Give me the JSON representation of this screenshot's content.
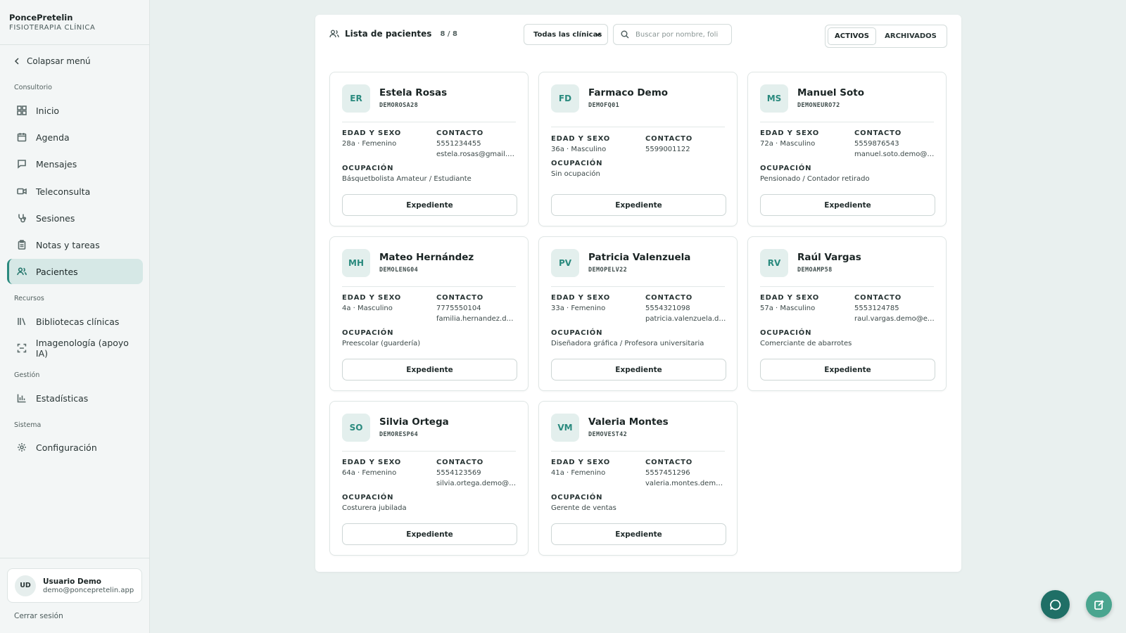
{
  "brand": {
    "name": "PoncePretelin",
    "subtitle": "FISIOTERAPIA CLÍNICA"
  },
  "sidebar": {
    "collapse_label": "Colapsar menú",
    "sections": {
      "consultorio": "Consultorio",
      "recursos": "Recursos",
      "gestion": "Gestión",
      "sistema": "Sistema"
    },
    "items": [
      {
        "label": "Inicio",
        "icon": "grid-icon"
      },
      {
        "label": "Agenda",
        "icon": "calendar-icon"
      },
      {
        "label": "Mensajes",
        "icon": "message-icon"
      },
      {
        "label": "Teleconsulta",
        "icon": "video-icon"
      },
      {
        "label": "Sesiones",
        "icon": "stethoscope-icon"
      },
      {
        "label": "Notas y tareas",
        "icon": "clipboard-icon"
      },
      {
        "label": "Pacientes",
        "icon": "users-icon",
        "active": true
      },
      {
        "label": "Bibliotecas clínicas",
        "icon": "library-icon"
      },
      {
        "label": "Imagenología (apoyo IA)",
        "icon": "scan-icon"
      },
      {
        "label": "Estadísticas",
        "icon": "bar-chart-icon"
      },
      {
        "label": "Configuración",
        "icon": "gear-icon"
      }
    ],
    "user": {
      "initials": "UD",
      "name": "Usuario Demo",
      "email": "demo@poncepretelin.app"
    },
    "logout_label": "Cerrar sesión"
  },
  "main": {
    "title": "Lista de pacientes",
    "count": "8 / 8",
    "clinic_select": "Todas las clínicas",
    "search_placeholder": "Buscar por nombre, foli",
    "tabs": {
      "active": "ACTIVOS",
      "archived": "ARCHIVADOS"
    },
    "labels": {
      "age_sex": "EDAD Y SEXO",
      "contact": "CONTACTO",
      "occupation": "OCUPACIÓN",
      "record_button": "Expediente"
    },
    "patients": [
      {
        "initials": "ER",
        "name": "Estela Rosas",
        "code": "DEMOROSA28",
        "age_sex": "28a · Femenino",
        "phone": "5551234455",
        "email": "estela.rosas@gmail.com",
        "occupation": "Básquetbolista Amateur / Estudiante"
      },
      {
        "initials": "FD",
        "name": "Farmaco Demo",
        "code": "DEMOFQ01",
        "age_sex": "36a · Masculino",
        "phone": "5599001122",
        "email": "",
        "occupation": "Sin ocupación"
      },
      {
        "initials": "MS",
        "name": "Manuel Soto",
        "code": "DEMONEURO72",
        "age_sex": "72a · Masculino",
        "phone": "5559876543",
        "email": "manuel.soto.demo@example.com",
        "occupation": "Pensionado / Contador retirado"
      },
      {
        "initials": "MH",
        "name": "Mateo Hernández",
        "code": "DEMOLENG04",
        "age_sex": "4a · Masculino",
        "phone": "7775550104",
        "email": "familia.hernandez.demo@example.com",
        "occupation": "Preescolar (guardería)"
      },
      {
        "initials": "PV",
        "name": "Patricia Valenzuela",
        "code": "DEMOPELV22",
        "age_sex": "33a · Femenino",
        "phone": "5554321098",
        "email": "patricia.valenzuela.demo@example.com",
        "occupation": "Diseñadora gráfica / Profesora universitaria"
      },
      {
        "initials": "RV",
        "name": "Raúl Vargas",
        "code": "DEMOAMP58",
        "age_sex": "57a · Masculino",
        "phone": "5553124785",
        "email": "raul.vargas.demo@example.com",
        "occupation": "Comerciante de abarrotes"
      },
      {
        "initials": "SO",
        "name": "Silvia Ortega",
        "code": "DEMORESP64",
        "age_sex": "64a · Femenino",
        "phone": "5554123569",
        "email": "silvia.ortega.demo@example.com",
        "occupation": "Costurera jubilada"
      },
      {
        "initials": "VM",
        "name": "Valeria Montes",
        "code": "DEMOVEST42",
        "age_sex": "41a · Femenino",
        "phone": "5557451296",
        "email": "valeria.montes.demo@example.com",
        "occupation": "Gerente de ventas"
      }
    ]
  },
  "colors": {
    "accent": "#2a8a7e",
    "fab_dark": "#1f6f66",
    "fab_light": "#4aa58f"
  }
}
